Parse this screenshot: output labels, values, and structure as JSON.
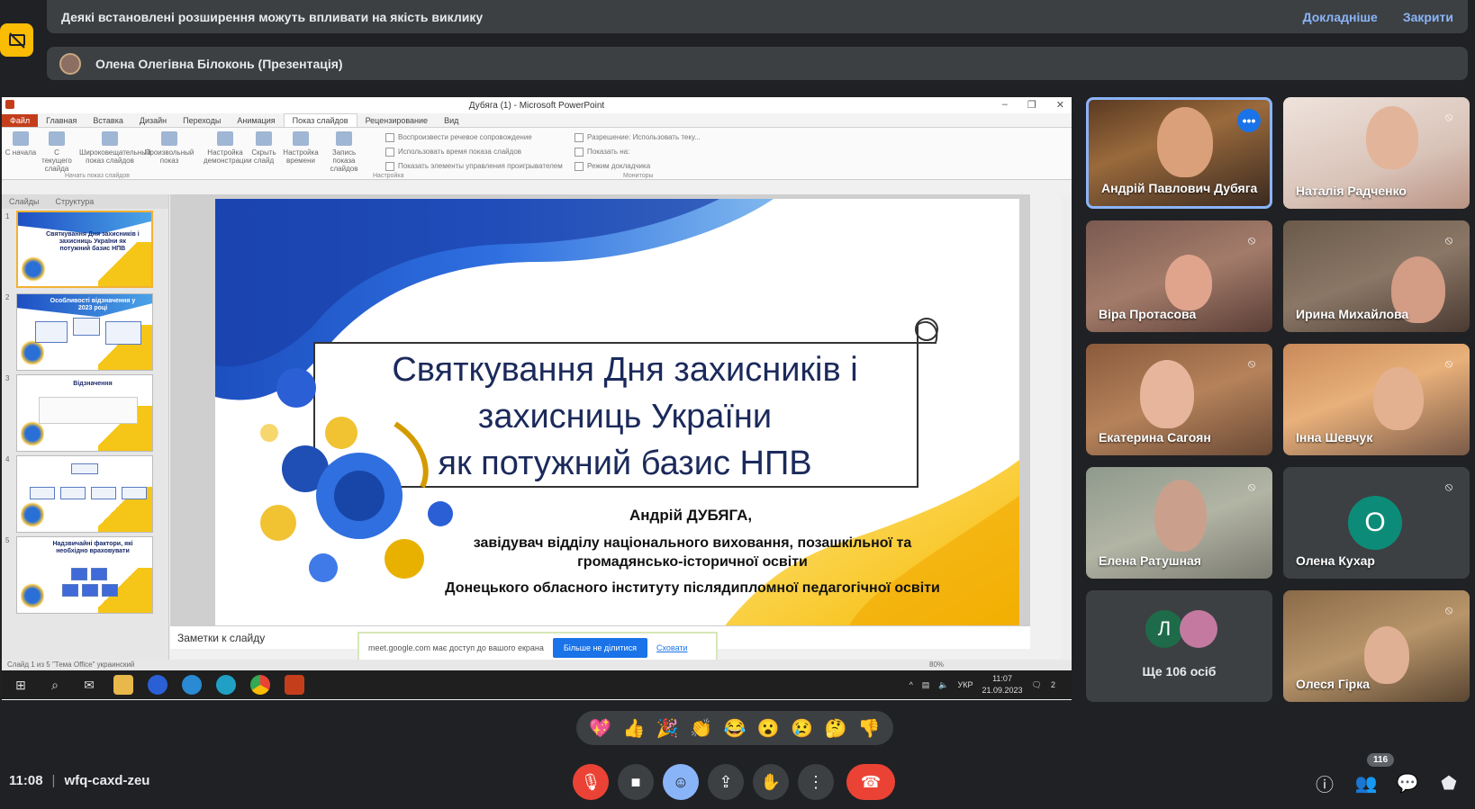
{
  "banner": {
    "text": "Деякі встановлені розширення можуть впливати на якість виклику",
    "details_link": "Докладніше",
    "close_link": "Закрити"
  },
  "presenter": {
    "name": "Олена Олегівна Білоконь (Презентація)"
  },
  "powerpoint": {
    "window_title": "Дубяга (1) - Microsoft PowerPoint",
    "tabs": [
      "Файл",
      "Главная",
      "Вставка",
      "Дизайн",
      "Переходы",
      "Анимация",
      "Показ слайдов",
      "Рецензирование",
      "Вид"
    ],
    "active_tab": "Показ слайдов",
    "ribbon_buttons": [
      "С начала",
      "С текущего слайда",
      "Широковещательный показ слайдов",
      "Произвольный показ",
      "Настройка демонстрации",
      "Скрыть слайд",
      "Настройка времени",
      "Запись показа слайдов"
    ],
    "ribbon_options": [
      "Воспроизвести речевое сопровождение",
      "Использовать время показа слайдов",
      "Показать элементы управления проигрывателем",
      "Разрешение:  Использовать теку...",
      "Показать на:",
      "Режим докладчика"
    ],
    "ribbon_groups": [
      "Начать показ слайдов",
      "Настройка",
      "Мониторы"
    ],
    "left_tabs": [
      "Слайды",
      "Структура"
    ],
    "slide_numbers": [
      "1",
      "2",
      "3",
      "4",
      "5"
    ],
    "thumb_titles": [
      "Святкування Дня захисників і захисниць України як потужний базис НПВ",
      "Особливості відзначення у 2023 році",
      "Відзначення",
      "",
      "Надзвичайні фактори, які необхідно враховувати"
    ],
    "notes_placeholder": "Заметки к слайду",
    "status_text": "Слайд 1 из 5   \"Тема Office\"   украинский",
    "zoom": "80%"
  },
  "slide": {
    "title_line1": "Святкування Дня захисників і",
    "title_line2": "захисниць України",
    "title_line3": "як потужний базис НПВ",
    "author": "Андрій ДУБЯГА,",
    "position_line1": "завідувач відділу національного виховання, позашкільної та",
    "position_line2": "громадянсько-історичної освіти",
    "institution": "Донецького обласного інституту післядипломної педагогічної освіти"
  },
  "share_notice": {
    "text": "meet.google.com має доступ до вашого екрана",
    "stop_button": "Більше не ділитися",
    "hide_link": "Сховати"
  },
  "taskbar": {
    "lang": "УКР",
    "time": "11:07",
    "date": "21.09.2023",
    "notifications": "2"
  },
  "participants": [
    {
      "name": "Андрій Павлович Дубяга",
      "speaking": true
    },
    {
      "name": "Наталія Радченко"
    },
    {
      "name": "Віра Протасова"
    },
    {
      "name": "Ирина Михайлова"
    },
    {
      "name": "Екатерина Сагоян"
    },
    {
      "name": "Інна Шевчук"
    },
    {
      "name": "Елена Ратушная"
    },
    {
      "name": "Олена Кухар",
      "initial": "О"
    },
    {
      "name": "Ще 106 осіб",
      "initial": "Л"
    },
    {
      "name": "Олеся Гірка"
    }
  ],
  "reactions": [
    "💖",
    "👍",
    "🎉",
    "👏",
    "😂",
    "😮",
    "😢",
    "🤔",
    "👎"
  ],
  "bottom": {
    "time": "11:08",
    "meeting_code": "wfq-caxd-zeu",
    "participant_count": "116"
  },
  "colors": {
    "background": "#202124",
    "panel": "#3c4043",
    "accent_blue": "#8ab4f8",
    "hangup_red": "#ea4335",
    "avatar_teal": "#0c8c78"
  }
}
